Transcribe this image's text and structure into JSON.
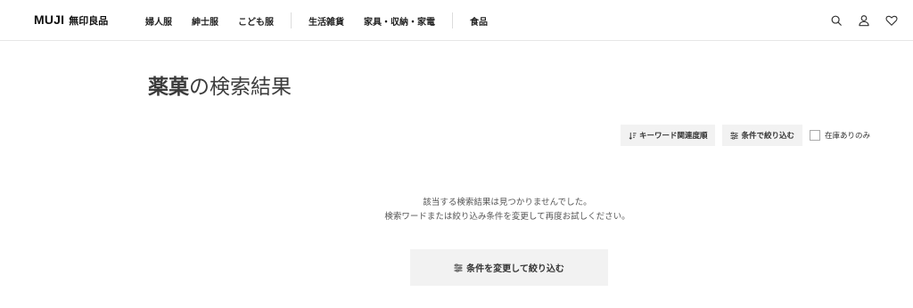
{
  "header": {
    "logo_en": "MUJI",
    "logo_jp": "無印良品",
    "nav": [
      "婦人服",
      "紳士服",
      "こども服",
      "生活雑貨",
      "家具・収納・家電",
      "食品"
    ],
    "icons": [
      "search-icon",
      "account-icon",
      "favorite-heart-icon"
    ]
  },
  "title": {
    "keyword": "薬菓",
    "suffix": "の検索結果"
  },
  "controls": {
    "sort_label": "キーワード関連度順",
    "filter_label": "条件で絞り込む",
    "in_stock_label": "在庫ありのみ",
    "in_stock_checked": false
  },
  "empty": {
    "line1": "該当する検索結果は見つかりませんでした。",
    "line2": "検索ワードまたは絞り込み条件を変更して再度お試しください。"
  },
  "cta_label": "条件を変更して絞り込む"
}
